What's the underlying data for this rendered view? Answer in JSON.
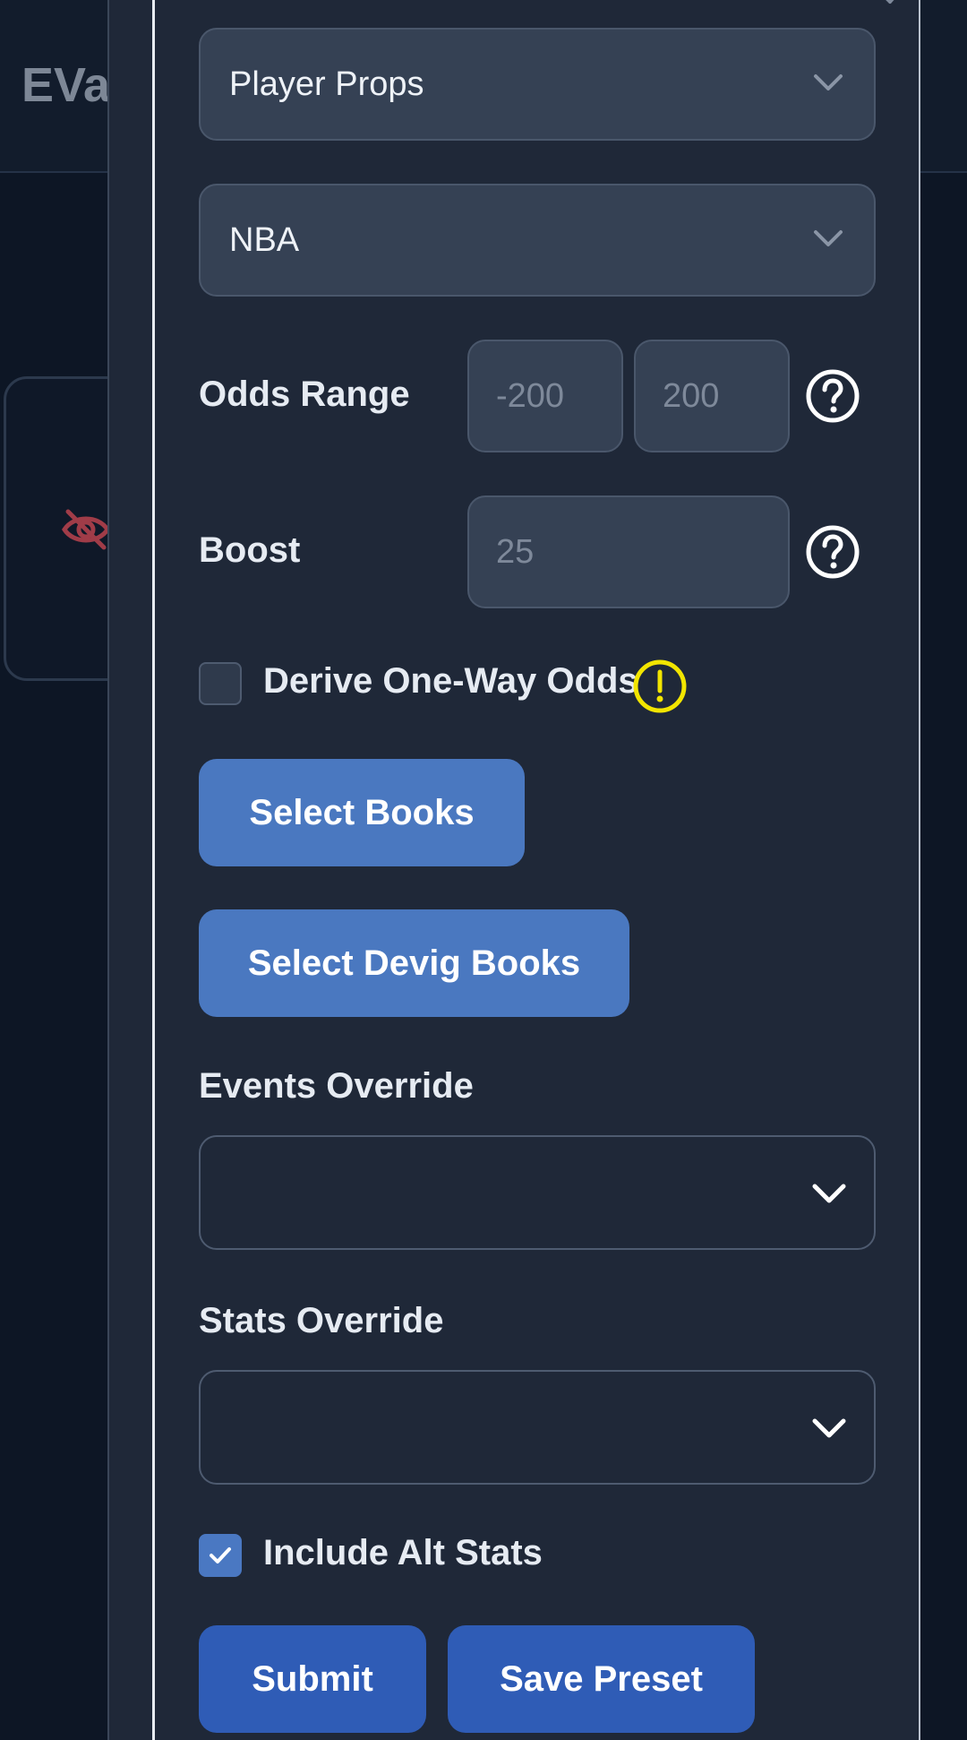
{
  "background": {
    "app_title": "EVa",
    "hidden_icon": "eye-slash-icon"
  },
  "modal": {
    "close_icon": "close-icon",
    "market_select": {
      "value": "Player Props",
      "icon": "chevron-down-icon"
    },
    "league_select": {
      "value": "NBA",
      "icon": "chevron-down-icon"
    },
    "odds_range": {
      "label": "Odds Range",
      "min_placeholder": "-200",
      "max_placeholder": "200",
      "help_icon": "question-circle-icon"
    },
    "boost": {
      "label": "Boost",
      "placeholder": "25",
      "help_icon": "question-circle-icon"
    },
    "derive_one_way": {
      "label": "Derive One-Way Odds",
      "checked": false,
      "warning_icon": "exclamation-circle-icon"
    },
    "select_books_label": "Select Books",
    "select_devig_books_label": "Select Devig Books",
    "events_override": {
      "label": "Events Override",
      "value": "",
      "icon": "chevron-down-icon"
    },
    "stats_override": {
      "label": "Stats Override",
      "value": "",
      "icon": "chevron-down-icon"
    },
    "include_alt_stats": {
      "label": "Include Alt Stats",
      "checked": true
    },
    "submit_label": "Submit",
    "save_preset_label": "Save Preset"
  },
  "colors": {
    "accent_button": "#4a78c0",
    "primary_button": "#2f5cb6",
    "warning": "#f2e500",
    "panel": "#1f2838"
  }
}
